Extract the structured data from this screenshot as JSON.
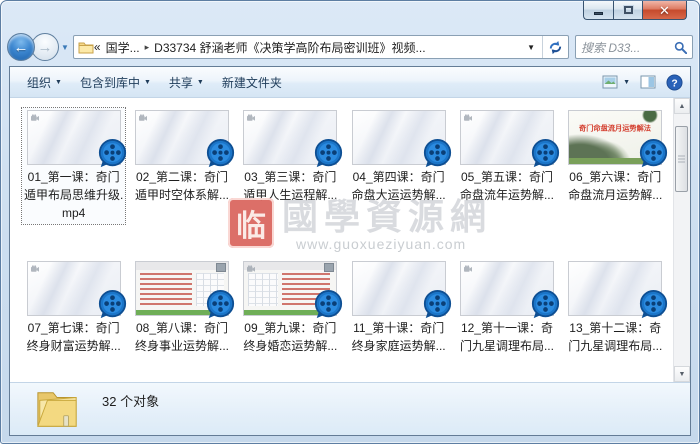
{
  "titlebar": {
    "minimize_label": "minimize",
    "maximize_label": "maximize",
    "close_glyph": "✕"
  },
  "navbar": {
    "back_glyph": "←",
    "forward_glyph": "→",
    "chevron_left": "«",
    "breadcrumb_root": "国学...",
    "crumb_separator": "▸",
    "breadcrumb_path": "D33734 舒涵老师《决策学高阶布局密训班》视频...",
    "address_caret": "▼",
    "search_placeholder": "搜索 D33..."
  },
  "toolbar": {
    "organize": "组织",
    "include_in_library": "包含到库中",
    "share": "共享",
    "new_folder": "新建文件夹",
    "caret": "▼",
    "help_glyph": "?"
  },
  "files": [
    {
      "name": "01_第一课：奇门遁甲布局思维升级.mp4",
      "thumb": "plain",
      "cam": true,
      "selected": true
    },
    {
      "name": "02_第二课：奇门遁甲时空体系解...",
      "thumb": "plain",
      "cam": true
    },
    {
      "name": "03_第三课：奇门遁甲人生运程解...",
      "thumb": "plain",
      "cam": true
    },
    {
      "name": "04_第四课：奇门命盘大运运势解...",
      "thumb": "plain",
      "cam": false
    },
    {
      "name": "05_第五课：奇门命盘流年运势解...",
      "thumb": "plain",
      "cam": true
    },
    {
      "name": "06_第六课：奇门命盘流月运势解...",
      "thumb": "landscape",
      "cam": false,
      "thumb_title": "奇门命盘流月运势解法"
    },
    {
      "name": "07_第七课：奇门终身财富运势解...",
      "thumb": "plain",
      "cam": true
    },
    {
      "name": "08_第八课：奇门终身事业运势解...",
      "thumb": "slide-a",
      "cam": false
    },
    {
      "name": "09_第九课：奇门终身婚恋运势解...",
      "thumb": "slide-b",
      "cam": true
    },
    {
      "name": "11_第十课：奇门终身家庭运势解...",
      "thumb": "plain",
      "cam": false
    },
    {
      "name": "12_第十一课：奇门九星调理布局...",
      "thumb": "plain",
      "cam": true
    },
    {
      "name": "13_第十二课：奇门九星调理布局...",
      "thumb": "plain",
      "cam": false
    }
  ],
  "watermark": {
    "seal_char": "临",
    "site_name": "國學資源網",
    "site_url": "www.guoxueziyuan.com"
  },
  "statusbar": {
    "object_count": "32 个对象"
  },
  "colors": {
    "accent_blue": "#1b75c8",
    "close_red": "#c64a2c",
    "seal_red": "#d6564e",
    "slide_green": "#6fae57"
  },
  "scrollbar": {
    "up_glyph": "▲",
    "down_glyph": "▼"
  }
}
